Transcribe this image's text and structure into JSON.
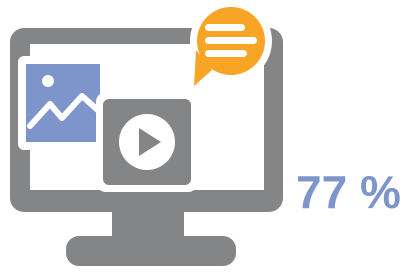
{
  "stat": {
    "value": 77,
    "label": "77 %"
  },
  "icons": {
    "monitor": "monitor-icon",
    "image": "image-icon",
    "video": "video-play-icon",
    "chat": "chat-bubble-icon"
  },
  "colors": {
    "monitor_gray": "#848587",
    "image_blue": "#7e95cc",
    "chat_orange": "#f8a425",
    "stat_blue": "#7e95cc",
    "background": "#ffffff"
  }
}
